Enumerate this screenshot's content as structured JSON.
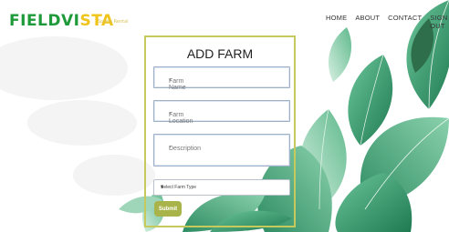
{
  "brand": {
    "logo_part1": "FIELDVI",
    "logo_part2": "STA",
    "tagline": "Sports Rental"
  },
  "nav": {
    "items": [
      "HOME",
      "ABOUT",
      "CONTACT",
      "SIGN OUT"
    ]
  },
  "form": {
    "title": "ADD FARM",
    "fields": [
      {
        "placeholder": "Farm Name",
        "required": "*"
      },
      {
        "placeholder": "Farm Location",
        "required": "*"
      },
      {
        "placeholder": "Description",
        "required": "*"
      }
    ],
    "farm_type_select": {
      "selected": "Select Farm Type"
    },
    "submit_label": "Submit"
  },
  "colors": {
    "logo_green": "#1e9a3a",
    "logo_yellow": "#f0c419",
    "card_border": "#c6c95b",
    "submit_bg": "#a8b34a",
    "leaf_green": "#3fa77a"
  }
}
